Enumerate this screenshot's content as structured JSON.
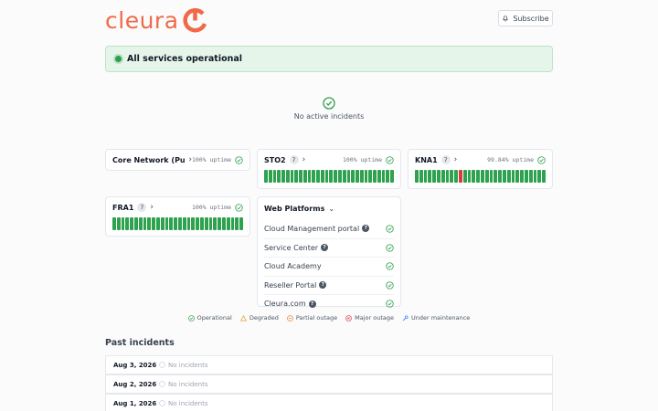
{
  "brand": {
    "name": "cleura",
    "color": "#f06a4a"
  },
  "header": {
    "subscribe_label": "Subscribe",
    "subscribe_icon": "bell-icon"
  },
  "banner": {
    "text": "All services operational",
    "color": "#2f9e4f"
  },
  "status": {
    "no_incidents": "No active incidents"
  },
  "services": {
    "core": {
      "title": "Core Network (Pu…",
      "uptime": "100% uptime"
    },
    "sto2": {
      "title": "STO2",
      "count": "7",
      "uptime": "100% uptime"
    },
    "kna1": {
      "title": "KNA1",
      "count": "7",
      "uptime": "99.84% uptime"
    },
    "fra1": {
      "title": "FRA1",
      "count": "7",
      "uptime": "100% uptime"
    },
    "web": {
      "title": "Web Platforms",
      "items": [
        {
          "label": "Cloud Management portal",
          "help": true
        },
        {
          "label": "Service Center",
          "help": true
        },
        {
          "label": "Cloud Academy",
          "help": false
        },
        {
          "label": "Reseller Portal",
          "help": true
        },
        {
          "label": "Cleura.com",
          "help": true
        }
      ]
    }
  },
  "legend": {
    "operational": "Operational",
    "degraded": "Degraded",
    "partial": "Partial outage",
    "major": "Major outage",
    "maintenance": "Under maintenance"
  },
  "past": {
    "title": "Past incidents",
    "rows": [
      {
        "date": "Aug 3, 2026",
        "text": "No incidents"
      },
      {
        "date": "Aug 2, 2026",
        "text": "No incidents"
      },
      {
        "date": "Aug 1, 2026",
        "text": "No incidents"
      }
    ]
  },
  "colors": {
    "bar_ok": "#2fa24f",
    "bar_bad": "#d93b3b"
  }
}
